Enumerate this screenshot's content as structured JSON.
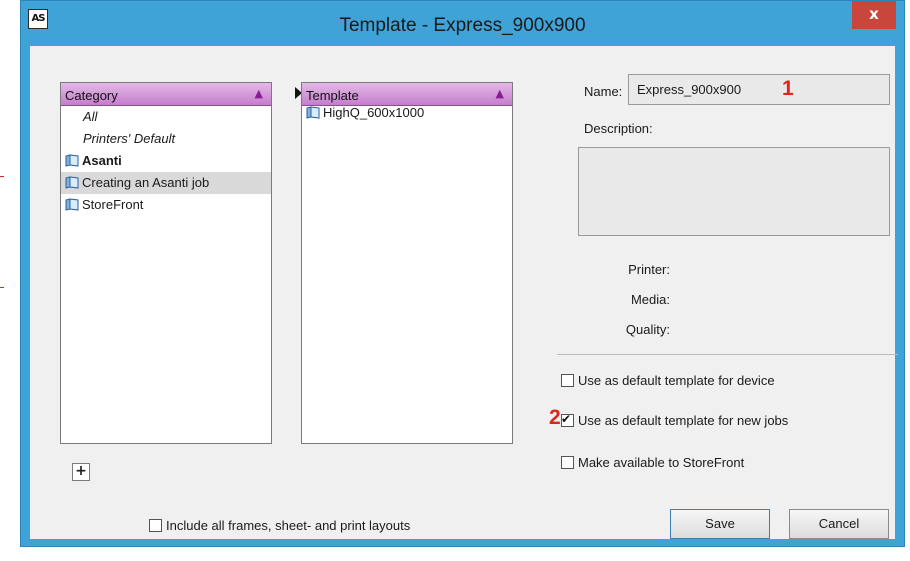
{
  "window": {
    "title": "Template - Express_900x900",
    "app_icon_text": "AS",
    "close_symbol": "x"
  },
  "category_panel": {
    "header": "Category",
    "items": [
      {
        "label": "All",
        "style": "italic"
      },
      {
        "label": "Printers' Default",
        "style": "italic"
      },
      {
        "label": "Asanti",
        "style": "bold",
        "icon": "folder-icon"
      },
      {
        "label": "Creating an Asanti job",
        "style": "selected",
        "icon": "folder-icon"
      },
      {
        "label": "StoreFront",
        "style": "normal",
        "icon": "folder-icon"
      }
    ],
    "add_button": "+"
  },
  "template_panel": {
    "header": "Template",
    "items": [
      {
        "label": "HighQ_600x1000",
        "icon": "folder-icon"
      }
    ]
  },
  "details": {
    "name_label": "Name:",
    "name_value": "Express_900x900",
    "description_label": "Description:",
    "description_value": "",
    "printer_label": "Printer:",
    "media_label": "Media:",
    "quality_label": "Quality:"
  },
  "options": {
    "default_device": {
      "label": "Use as default template for device",
      "checked": false
    },
    "default_new_jobs": {
      "label": "Use as default template for new jobs",
      "checked": true
    },
    "storefront": {
      "label": "Make available to StoreFront",
      "checked": false
    },
    "include_layouts": {
      "label": "Include all frames, sheet- and print layouts",
      "checked": false
    }
  },
  "annotations": {
    "one": "1",
    "two": "2"
  },
  "buttons": {
    "save": "Save",
    "cancel": "Cancel"
  },
  "colors": {
    "window_frame": "#3fa3d8",
    "close_button": "#c9463d",
    "header_purple": "#c47dcb",
    "annotation_red": "#e2231a"
  }
}
